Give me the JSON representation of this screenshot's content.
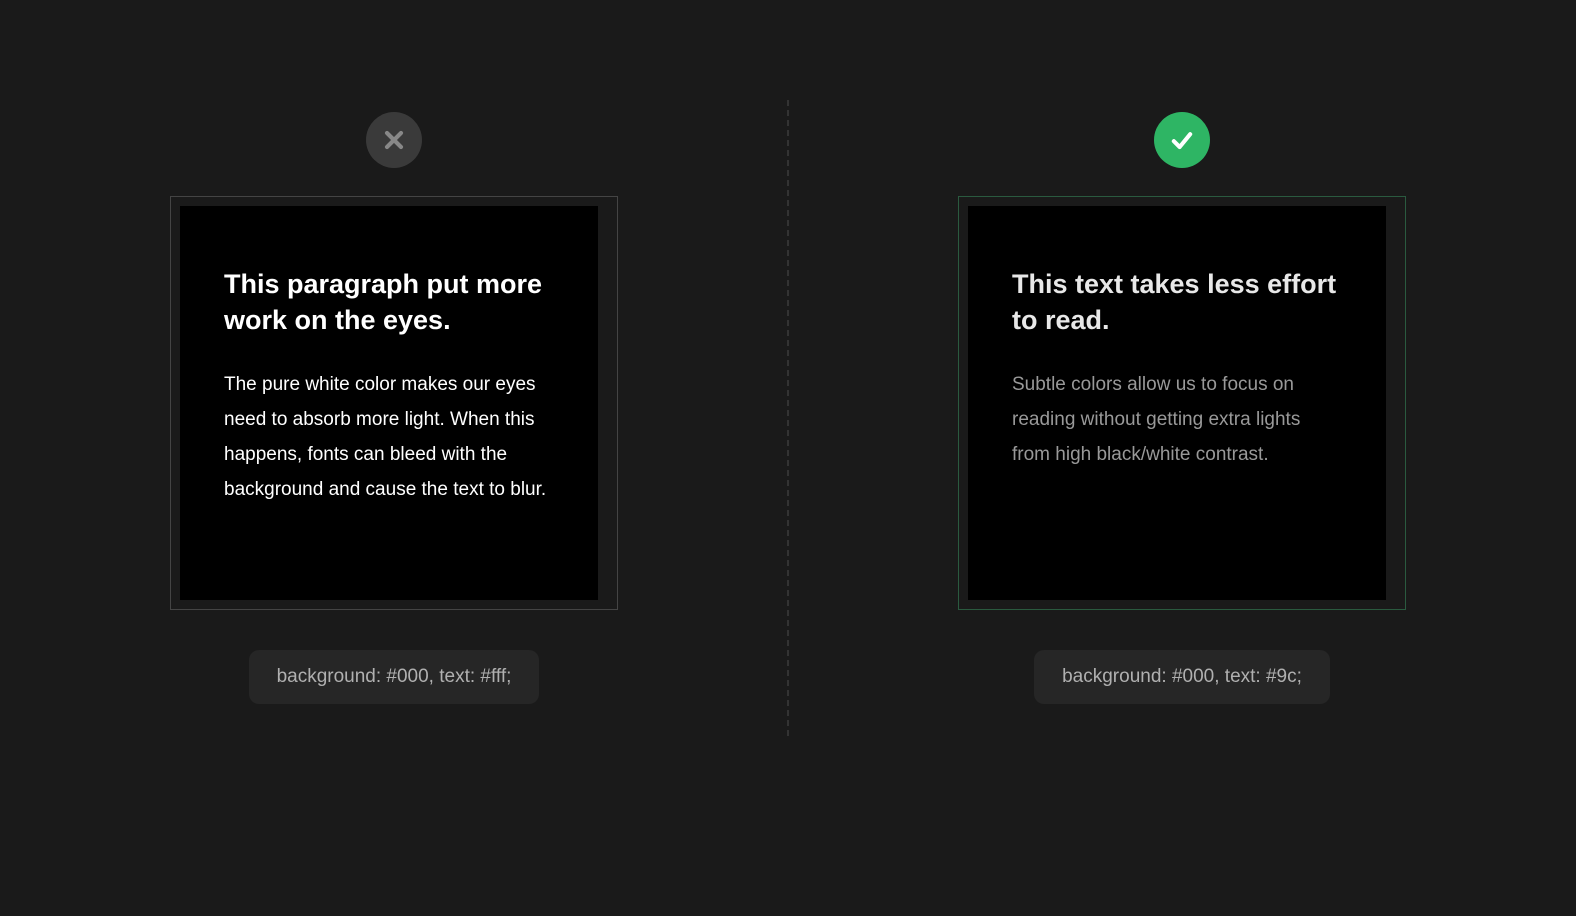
{
  "left": {
    "title": "This paragraph put more work on the eyes.",
    "body": "The pure white color makes our eyes need to absorb more light. When this happens, fonts can bleed with the background and cause the text to blur.",
    "label": "background: #000, text: #fff;"
  },
  "right": {
    "title": "This text takes less effort to read.",
    "body": "Subtle colors allow us to focus on reading without getting extra lights from high black/white contrast.",
    "label": "background: #000, text: #9c;"
  },
  "colors": {
    "bad_icon_bg": "#3a3a3a",
    "good_icon_bg": "#2eb564",
    "left_text": "#ffffff",
    "right_title": "#e8e8e8",
    "right_body": "#999999"
  }
}
